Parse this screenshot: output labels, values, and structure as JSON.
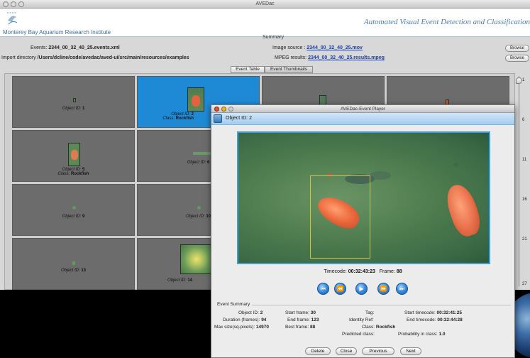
{
  "main_window": {
    "title": "AVEDac"
  },
  "header": {
    "org_name": "Monterey Bay Aquarium Research Institute",
    "tagline": "Automated Visual Event Detection and Classification"
  },
  "summary": {
    "title": "Summary",
    "events_label": "Events:",
    "events_value": "2344_00_32_40_25.events.xml",
    "import_label": "Import directory",
    "import_value": "/Users/dcline/code/avedac/aved-ui/src/main/resources/examples",
    "image_source_label": "Image source :",
    "image_source_value": "2344_00_32_40_25.mov",
    "mpeg_label": "MPEG results:",
    "mpeg_value": "2344_00_32_40_25.results.mpeg",
    "browse_label_1": "Browse",
    "browse_label_2": "Browse"
  },
  "tabs": [
    {
      "label": "Event Table",
      "active": false
    },
    {
      "label": "Event Thumbnails",
      "active": true
    }
  ],
  "thumbnails": [
    {
      "object_label": "Object ID:",
      "object_id": "1",
      "class_label": "",
      "class_value": ""
    },
    {
      "object_label": "Object ID:",
      "object_id": "2",
      "class_label": "Class:",
      "class_value": "Rockfish"
    },
    {
      "object_label": "",
      "object_id": "",
      "class_label": "",
      "class_value": ""
    },
    {
      "object_label": "",
      "object_id": "",
      "class_label": "",
      "class_value": ""
    },
    {
      "object_label": "Object ID:",
      "object_id": "5",
      "class_label": "Class:",
      "class_value": "Rockfish"
    },
    {
      "object_label": "Object ID:",
      "object_id": "6",
      "class_label": "",
      "class_value": ""
    },
    {
      "object_label": "Object ID:",
      "object_id": "9",
      "class_label": "",
      "class_value": ""
    },
    {
      "object_label": "Object ID:",
      "object_id": "10",
      "class_label": "",
      "class_value": ""
    },
    {
      "object_label": "Object ID:",
      "object_id": "13",
      "class_label": "",
      "class_value": ""
    },
    {
      "object_label": "Object ID:",
      "object_id": "14",
      "class_label": "",
      "class_value": ""
    }
  ],
  "slider": {
    "ticks": [
      "1",
      "6",
      "11",
      "16",
      "21",
      "27"
    ]
  },
  "player": {
    "title": "AVEDac-Event Player",
    "header_title": "Object ID: 2",
    "timecode_label": "Timecode:",
    "timecode_value": "00:32:43:23",
    "frame_label": "Frame:",
    "frame_value": "88",
    "controls": [
      "first-icon",
      "rewind-icon",
      "play-icon",
      "fast-forward-icon",
      "last-icon"
    ],
    "summary_legend": "Event Summary",
    "fields": {
      "object_id_label": "Object ID:",
      "object_id_value": "2",
      "duration_label": "Duration (frames):",
      "duration_value": "94",
      "maxsize_label": "Max size(sq.pixels):",
      "maxsize_value": "14970",
      "start_frame_label": "Start frame:",
      "start_frame_value": "30",
      "end_frame_label": "End frame:",
      "end_frame_value": "123",
      "best_frame_label": "Best frame:",
      "best_frame_value": "88",
      "tag_label": "Tag:",
      "tag_value": "",
      "identity_label": "Identity Ref:",
      "identity_value": "",
      "class_label": "Class:",
      "class_value": "Rockfish",
      "predicted_label": "Predicted class:",
      "predicted_value": "",
      "start_tc_label": "Start timecode:",
      "start_tc_value": "00:32:41:25",
      "end_tc_label": "End timecode:",
      "end_tc_value": "00:32:44:28",
      "prob_label": "Probability in class:",
      "prob_value": "1.0"
    },
    "buttons": {
      "delete": "Delete",
      "close": "Close",
      "previous": "Previous",
      "next": "Next"
    }
  },
  "colors": {
    "selection": "#1e8ad6",
    "accent": "#3aa0e6",
    "link": "#1a3fa8",
    "header_text": "#4a7db0"
  }
}
